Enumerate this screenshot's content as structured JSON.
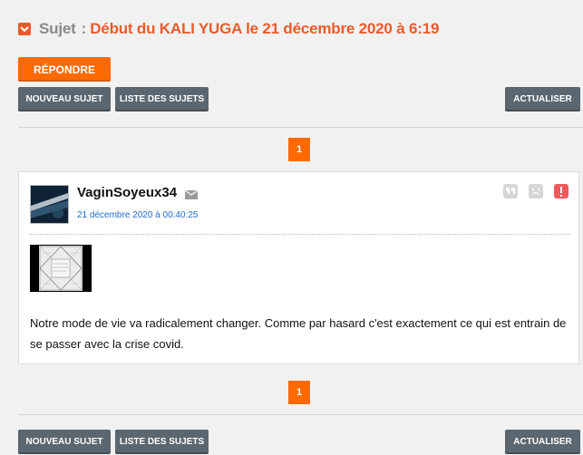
{
  "topic": {
    "label": "Sujet",
    "separator": ":",
    "title": "Début du KALI YUGA le 21 décembre 2020 à 6:19"
  },
  "buttons": {
    "reply": "RÉPONDRE",
    "new_topic": "NOUVEAU SUJET",
    "topic_list": "LISTE DES SUJETS",
    "refresh": "ACTUALISER"
  },
  "pagination": {
    "current_page": "1"
  },
  "post": {
    "username": "VaginSoyeux34",
    "date": "21 décembre 2020 à 00:40:25",
    "text": "Notre mode de vie va radicalement changer. Comme par hasard c'est exactement ce qui est entrain de se passer avec la crise covid.",
    "icons": [
      "mail-icon",
      "quote-icon",
      "sad-face-icon",
      "report-icon"
    ]
  },
  "colors": {
    "accent": "#ff6a00",
    "title": "#ea5b2c",
    "grey_button": "#5b6770",
    "report": "#f05a5a",
    "link": "#1f6bd0"
  }
}
